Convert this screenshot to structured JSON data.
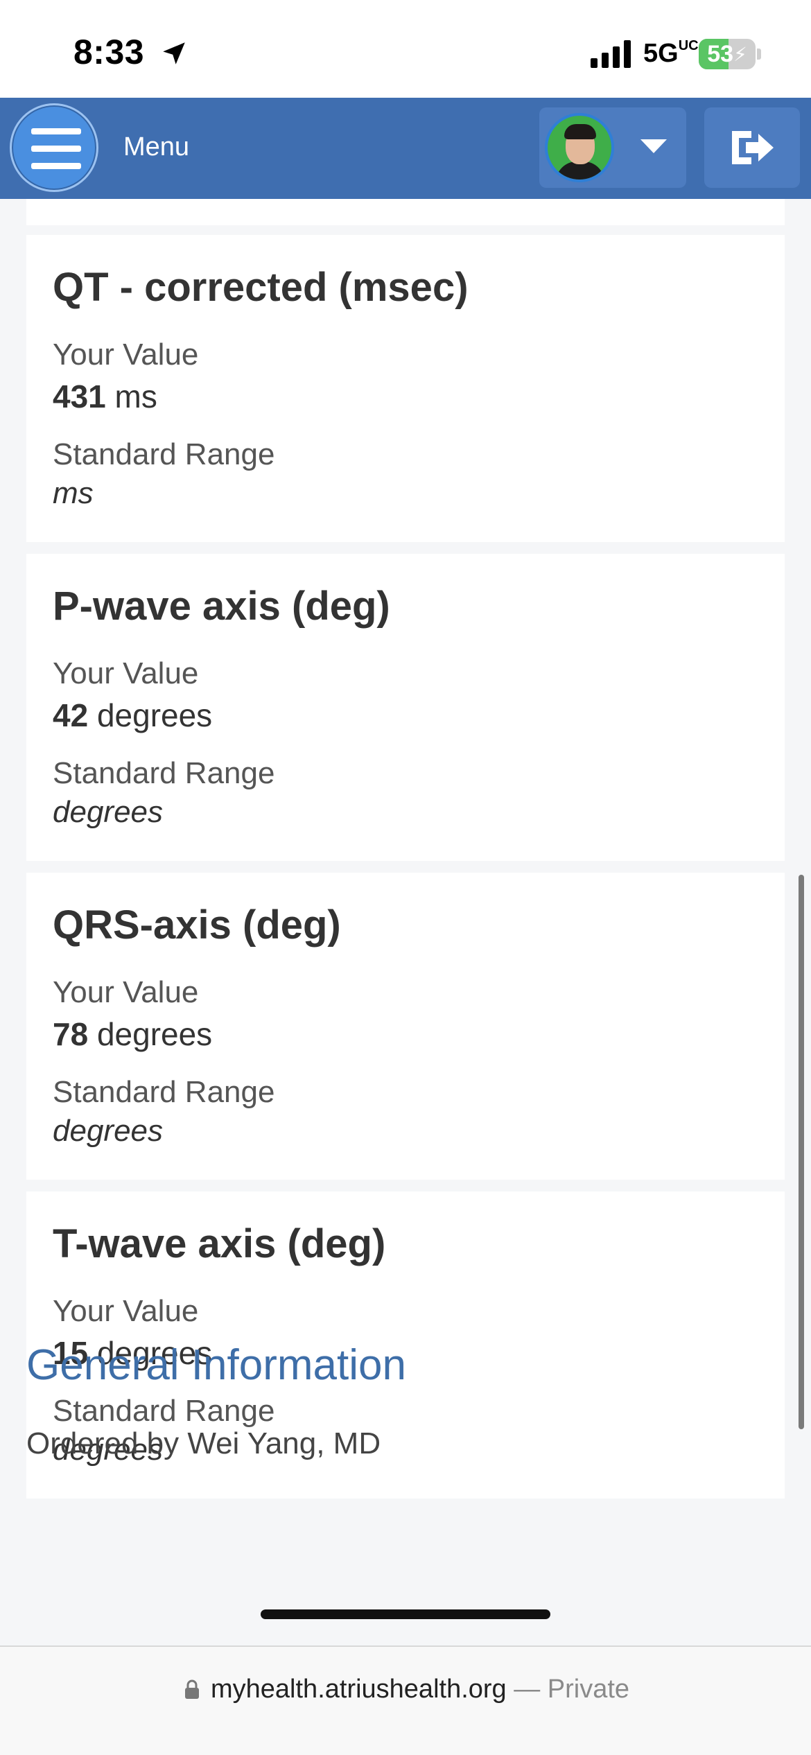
{
  "status_bar": {
    "time": "8:33",
    "network": "5G",
    "network_suffix": "UC",
    "battery_percent": "53",
    "battery_level": 0.53,
    "icons": [
      "location-arrow-icon",
      "signal-bars-icon",
      "battery-charging-icon"
    ]
  },
  "header": {
    "menu_label": "Menu",
    "menu_icon": "hamburger-icon",
    "profile_icon": "avatar",
    "dropdown_icon": "caret-down-icon",
    "logout_icon": "logout-icon",
    "colors": {
      "bar": "#3f6eb0",
      "button": "#4d7cc0",
      "menu_button": "#4a8fe0"
    }
  },
  "results": [
    {
      "title": "QT - corrected (msec)",
      "your_value_label": "Your Value",
      "value": "431",
      "unit": "ms",
      "standard_range_label": "Standard Range",
      "standard_range": "ms"
    },
    {
      "title": "P-wave axis (deg)",
      "your_value_label": "Your Value",
      "value": "42",
      "unit": "degrees",
      "standard_range_label": "Standard Range",
      "standard_range": "degrees"
    },
    {
      "title": "QRS-axis (deg)",
      "your_value_label": "Your Value",
      "value": "78",
      "unit": "degrees",
      "standard_range_label": "Standard Range",
      "standard_range": "degrees"
    },
    {
      "title": "T-wave axis (deg)",
      "your_value_label": "Your Value",
      "value": "15",
      "unit": "degrees",
      "standard_range_label": "Standard Range",
      "standard_range": "degrees"
    }
  ],
  "general_information": {
    "heading": "General Information",
    "ordered_by": "Ordered by Wei Yang, MD"
  },
  "browser": {
    "url": "myhealth.atriushealth.org",
    "suffix": " — Private",
    "lock_icon": "lock-icon"
  }
}
